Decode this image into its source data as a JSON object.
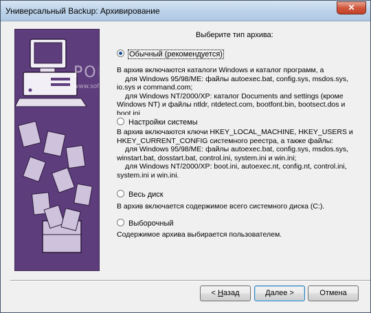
{
  "window": {
    "title": "Универсальный Backup: Архивирование",
    "close_label": "✕"
  },
  "watermark": {
    "brand": "PORTAL",
    "url": "www.softportal.com"
  },
  "heading": "Выберите тип архива:",
  "options": [
    {
      "label": "Обычный (рекомендуется)",
      "checked": true,
      "desc": [
        "В архив включаются каталоги Windows и каталог программ, а",
        "для Windows 95/98/ME: файлы autoexec.bat, config.sys, msdos.sys,",
        "io.sys и command.com;",
        "для Windows NT/2000/XP: каталог Documents and settings (кроме",
        "Windows NT) и файлы ntldr, ntdetect.com, bootfont.bin, bootsect.dos и",
        "boot.ini"
      ]
    },
    {
      "label": "Настройки системы",
      "checked": false,
      "desc": [
        "В архив включаются ключи HKEY_LOCAL_MACHINE, HKEY_USERS и",
        "HKEY_CURRENT_CONFIG системного реестра, а также файлы:",
        "для Windows 95/98/ME: файлы autoexec.bat, config.sys, msdos.sys,",
        "winstart.bat, dosstart.bat, control.ini, system.ini и win.ini;",
        "для Windows NT/2000/XP: boot.ini, autoexec.nt, config.nt, control.ini,",
        "system.ini и win.ini."
      ]
    },
    {
      "label": "Весь диск",
      "checked": false,
      "desc": [
        "В архив включается содержимое всего системного диска (C:)."
      ]
    },
    {
      "label": "Выборочный",
      "checked": false,
      "desc": [
        "Содержимое архива выбирается пользователем."
      ]
    }
  ],
  "buttons": {
    "back_prefix": "< ",
    "back_key": "Н",
    "back_rest": "азад",
    "next_prefix": "",
    "next_key": "Д",
    "next_rest": "алее >",
    "cancel": "Отмена"
  }
}
